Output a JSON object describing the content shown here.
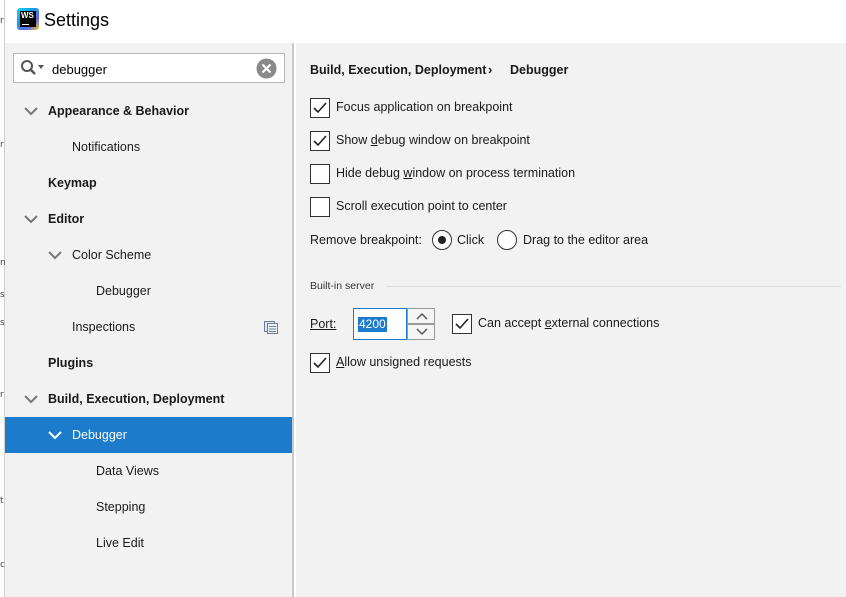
{
  "window": {
    "title": "Settings",
    "app_icon_letters": "WS"
  },
  "search": {
    "value": "debugger"
  },
  "tree": {
    "appearance_behavior": "Appearance & Behavior",
    "notifications": "Notifications",
    "keymap": "Keymap",
    "editor": "Editor",
    "color_scheme": "Color Scheme",
    "color_scheme_debugger": "Debugger",
    "inspections": "Inspections",
    "plugins": "Plugins",
    "build_execution_deployment": "Build, Execution, Deployment",
    "debugger": "Debugger",
    "data_views": "Data Views",
    "stepping": "Stepping",
    "live_edit": "Live Edit",
    "selected": "Debugger"
  },
  "breadcrumb": {
    "parent": "Build, Execution, Deployment",
    "separator": "›",
    "current": "Debugger"
  },
  "options": {
    "focus_app": {
      "label": "Focus application on breakpoint",
      "checked": true
    },
    "show_debug_pre": "Show ",
    "show_debug_u": "d",
    "show_debug_post": "ebug window on breakpoint",
    "show_debug_checked": true,
    "hide_debug_pre": "Hide debug ",
    "hide_debug_u": "w",
    "hide_debug_post": "indow on process termination",
    "hide_debug_checked": false,
    "scroll_exec": {
      "label": "Scroll execution point to center",
      "checked": false
    },
    "remove_breakpoint_label": "Remove breakpoint:",
    "remove_click": "Click",
    "remove_drag": "Drag to the editor area",
    "remove_selected": "Click"
  },
  "builtin_server": {
    "title": "Built-in server",
    "port_label": "Port:",
    "port_value": "4200",
    "external_pre": "Can accept ",
    "external_u": "e",
    "external_post": "xternal connections",
    "external_checked": true,
    "unsigned_u": "A",
    "unsigned_post": "llow unsigned requests",
    "unsigned_checked": true
  },
  "colors": {
    "selection": "#1c7ccb",
    "panel_bg": "#f2f2f2"
  }
}
